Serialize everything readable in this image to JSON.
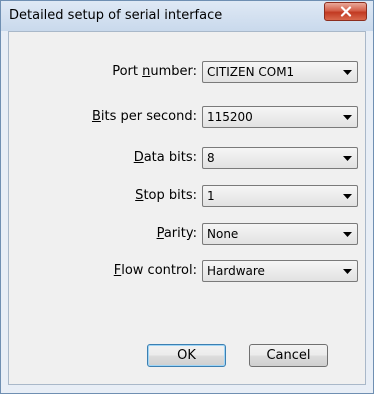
{
  "window": {
    "title": "Detailed setup of serial interface"
  },
  "fields": [
    {
      "label_before": "Port ",
      "label_accel": "n",
      "label_after": "umber:",
      "value": "CITIZEN COM1"
    },
    {
      "label_before": "",
      "label_accel": "B",
      "label_after": "its per second:",
      "value": "115200"
    },
    {
      "label_before": "",
      "label_accel": "D",
      "label_after": "ata bits:",
      "value": "8"
    },
    {
      "label_before": "",
      "label_accel": "S",
      "label_after": "top bits:",
      "value": "1"
    },
    {
      "label_before": "",
      "label_accel": "P",
      "label_after": "arity:",
      "value": "None"
    },
    {
      "label_before": "",
      "label_accel": "F",
      "label_after": "low control:",
      "value": "Hardware"
    }
  ],
  "buttons": {
    "ok_label": "OK",
    "cancel_label": "Cancel"
  },
  "icons": {
    "close": "close-icon",
    "dropdown": "chevron-down-icon"
  },
  "colors": {
    "close_button": "#c23a22",
    "window_frame": "#c9d9ec",
    "dialog_face": "#f0f0f0"
  }
}
